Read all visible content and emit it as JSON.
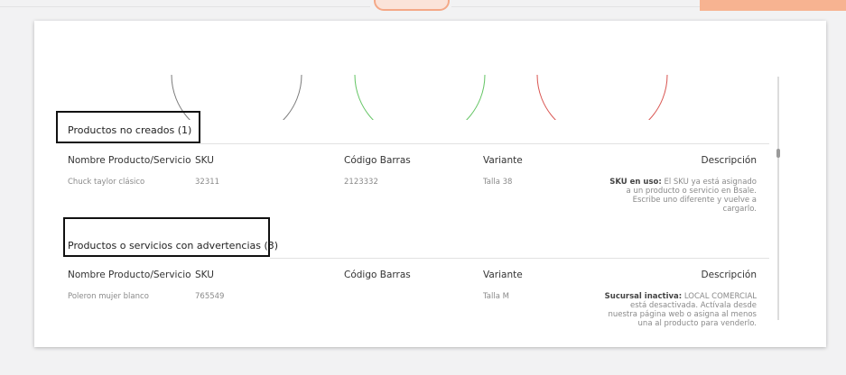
{
  "colors": {
    "accent": "#f7b391",
    "arc_gray": "#7a7a7a",
    "arc_green": "#62c462",
    "arc_red": "#d9534f"
  },
  "sections": [
    {
      "title": "Productos no creados (1)",
      "headers": {
        "name": "Nombre Producto/Servicio",
        "sku": "SKU",
        "barcode": "Código Barras",
        "variant": "Variante",
        "description": "Descripción"
      },
      "rows": [
        {
          "name": "Chuck taylor clásico",
          "sku": "32311",
          "barcode": "2123332",
          "variant": "Talla 38",
          "desc_label": "SKU en uso:",
          "desc_text": "El SKU ya está asignado a un producto o servicio en Bsale. Escribe uno diferente y vuelve a cargarlo."
        }
      ]
    },
    {
      "title": "Productos o servicios con advertencias (3)",
      "headers": {
        "name": "Nombre Producto/Servicio",
        "sku": "SKU",
        "barcode": "Código Barras",
        "variant": "Variante",
        "description": "Descripción"
      },
      "rows": [
        {
          "name": "Poleron mujer blanco",
          "sku": "765549",
          "barcode": "",
          "variant": "Talla M",
          "desc_label": "Sucursal inactiva:",
          "desc_text": "LOCAL COMERCIAL está desactivada. Actívala desde nuestra página web o asigna al menos una al producto para venderlo."
        }
      ]
    }
  ]
}
